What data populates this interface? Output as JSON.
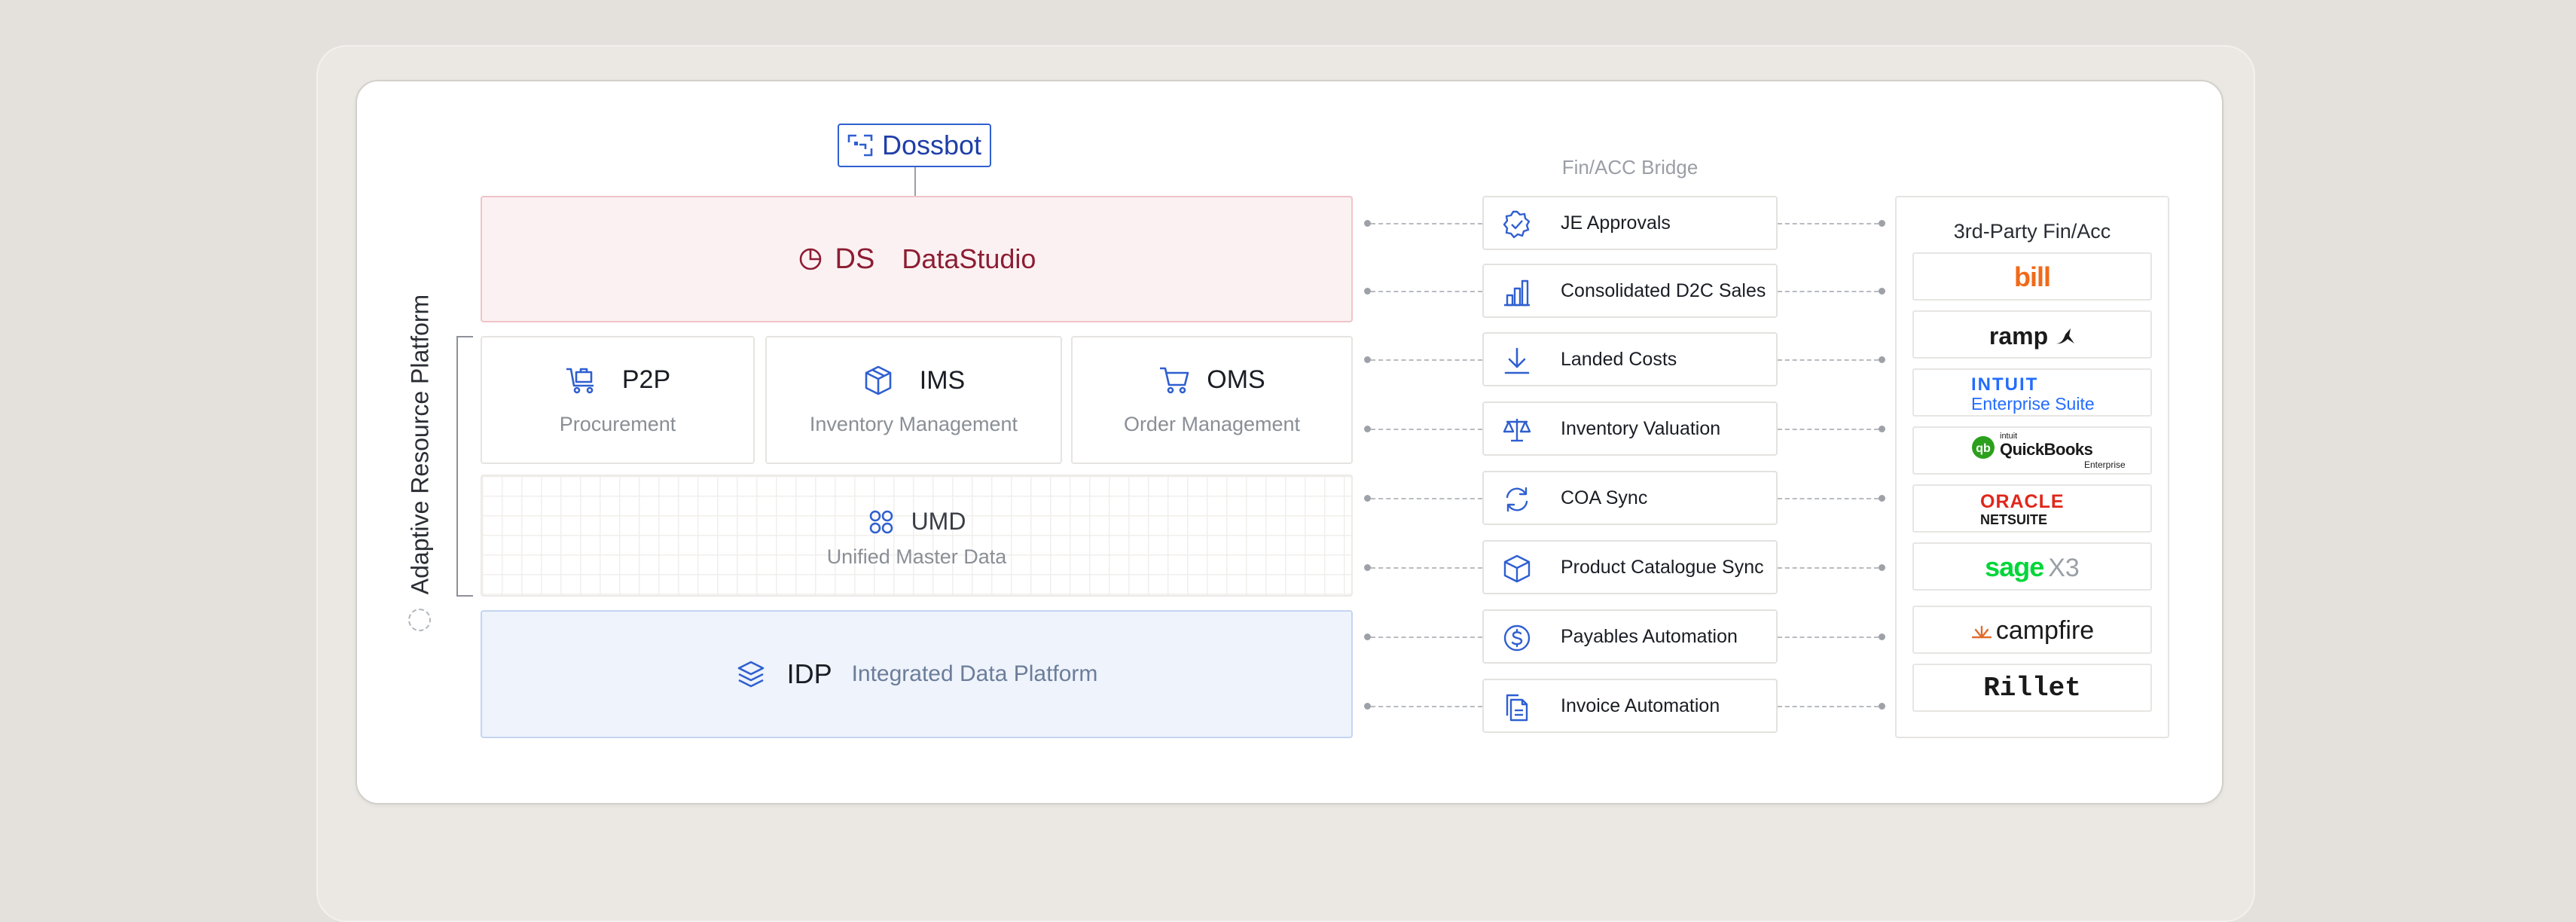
{
  "dossbot": {
    "label": "Dossbot"
  },
  "datastudio": {
    "abbr": "DS",
    "name": "DataStudio"
  },
  "modules": [
    {
      "abbr": "P2P",
      "name": "Procurement"
    },
    {
      "abbr": "IMS",
      "name": "Inventory Management"
    },
    {
      "abbr": "OMS",
      "name": "Order Management"
    }
  ],
  "umd": {
    "abbr": "UMD",
    "name": "Unified Master Data"
  },
  "idp": {
    "abbr": "IDP",
    "name": "Integrated Data Platform"
  },
  "platform_label": "Adaptive Resource Platform",
  "bridge": {
    "title": "Fin/ACC Bridge",
    "items": [
      {
        "label": "JE Approvals",
        "icon": "badge-check-icon"
      },
      {
        "label": "Consolidated D2C Sales",
        "icon": "bar-chart-icon"
      },
      {
        "label": "Landed Costs",
        "icon": "download-arrow-icon"
      },
      {
        "label": "Inventory Valuation",
        "icon": "scale-icon"
      },
      {
        "label": "COA Sync",
        "icon": "sync-icon"
      },
      {
        "label": "Product Catalogue Sync",
        "icon": "box-icon"
      },
      {
        "label": "Payables Automation",
        "icon": "dollar-circle-icon"
      },
      {
        "label": "Invoice Automation",
        "icon": "documents-icon"
      }
    ]
  },
  "vendors": {
    "title": "3rd-Party Fin/Acc",
    "items": [
      {
        "name": "bill",
        "color": "#f06a1a"
      },
      {
        "name": "ramp",
        "color": "#1a1a1a"
      },
      {
        "name": "INTUIT",
        "sub": "Enterprise Suite",
        "color": "#236cff"
      },
      {
        "name": "QuickBooks",
        "prefix": "intuit",
        "sub": "Enterprise",
        "color": "#2ca01c"
      },
      {
        "name": "ORACLE",
        "sub": "NETSUITE",
        "color": "#e0271b"
      },
      {
        "name": "sage",
        "suffix": "X3",
        "color": "#00d639"
      },
      {
        "name": "campfire",
        "color": "#e06d2c"
      },
      {
        "name": "Rillet",
        "color": "#1a1a1a"
      }
    ]
  },
  "colors": {
    "accent": "#2f5fd0",
    "datastudio_text": "#8c1d33",
    "datastudio_bg": "#fcf1f2",
    "idp_bg": "#eef3fc"
  }
}
